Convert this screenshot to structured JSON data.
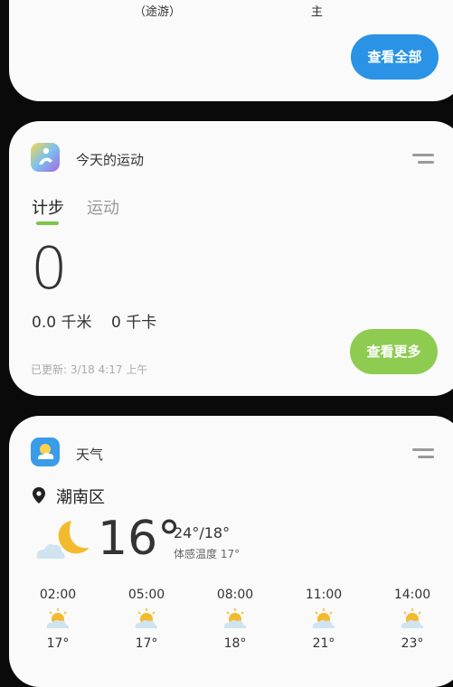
{
  "top_card": {
    "sub_left": "（途游）",
    "sub_right": "主",
    "view_all_label": "查看全部"
  },
  "sport": {
    "title": "今天的运动",
    "tabs": [
      {
        "label": "计步"
      },
      {
        "label": "运动"
      }
    ],
    "steps": "0",
    "distance": "0.0 千米",
    "calories": "0 千卡",
    "updated": "已更新: 3/18 4:17 上午",
    "more_label": "查看更多",
    "accent": "#8dcc50"
  },
  "weather": {
    "title": "天气",
    "location": "潮南区",
    "temp_now": "16°",
    "temp_range": "24°/18°",
    "feels_like": "体感温度 17°",
    "hours": [
      {
        "time": "02:00",
        "temp": "17°",
        "icon": "partly-cloudy-icon"
      },
      {
        "time": "05:00",
        "temp": "17°",
        "icon": "partly-cloudy-icon"
      },
      {
        "time": "08:00",
        "temp": "18°",
        "icon": "partly-cloudy-icon"
      },
      {
        "time": "11:00",
        "temp": "21°",
        "icon": "partly-cloudy-icon"
      },
      {
        "time": "14:00",
        "temp": "23°",
        "icon": "partly-cloudy-icon"
      }
    ]
  },
  "colors": {
    "blue_button": "#2a93e6",
    "green_button": "#8dcc50"
  }
}
